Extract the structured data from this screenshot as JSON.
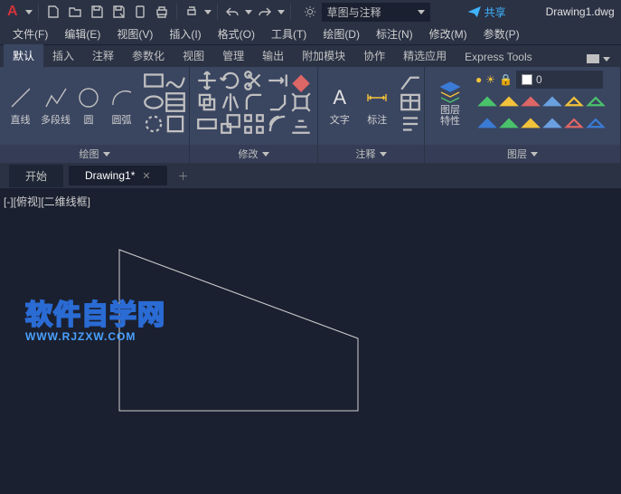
{
  "titlebar": {
    "app_letter": "A",
    "workspace_label": "草图与注释",
    "share_label": "共享",
    "doc_title": "Drawing1.dwg"
  },
  "menubar": {
    "items": [
      "文件(F)",
      "编辑(E)",
      "视图(V)",
      "插入(I)",
      "格式(O)",
      "工具(T)",
      "绘图(D)",
      "标注(N)",
      "修改(M)",
      "参数(P)"
    ]
  },
  "ribbon_tabs": {
    "items": [
      "默认",
      "插入",
      "注释",
      "参数化",
      "视图",
      "管理",
      "输出",
      "附加模块",
      "协作",
      "精选应用",
      "Express Tools"
    ],
    "active": 0
  },
  "ribbon": {
    "draw": {
      "title": "绘图",
      "line": "直线",
      "polyline": "多段线",
      "circle": "圆",
      "arc": "圆弧"
    },
    "modify": {
      "title": "修改"
    },
    "annotate": {
      "title": "注释",
      "text": "文字",
      "dim": "标注"
    },
    "layers": {
      "title": "图层",
      "props": "图层\n特性",
      "current": "0"
    }
  },
  "doc_tabs": {
    "start": "开始",
    "drawing": "Drawing1*"
  },
  "canvas": {
    "viewport_label": "[-][俯视][二维线框]",
    "watermark1": "软件自学网",
    "watermark2": "WWW.RJZXW.COM"
  }
}
